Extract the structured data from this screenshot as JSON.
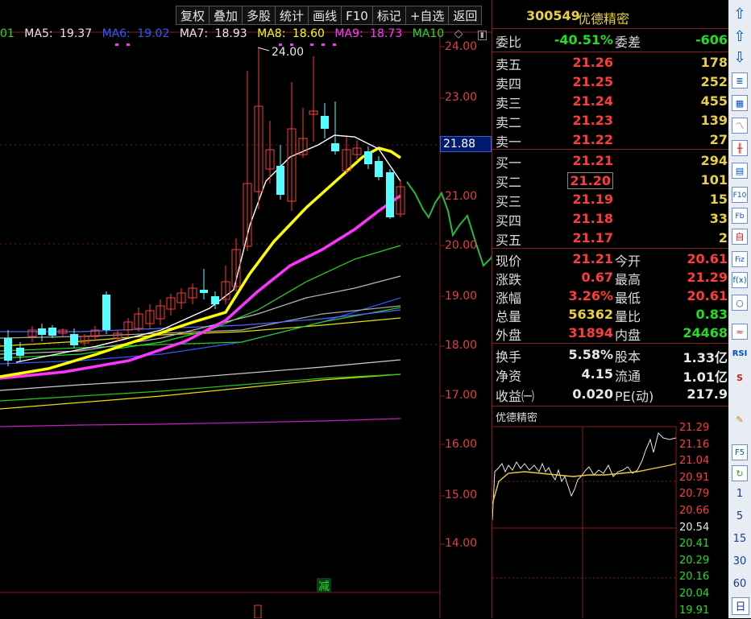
{
  "toolbar": {
    "items": [
      "复权",
      "叠加",
      "多股",
      "统计",
      "画线",
      "F10",
      "标记",
      "+自选",
      "返回"
    ]
  },
  "ma_legend": [
    {
      "label": "01",
      "value": "",
      "color": "#22dd22"
    },
    {
      "label": "MA5:",
      "value": "19.37",
      "color": "#e8e8e8"
    },
    {
      "label": "MA6:",
      "value": "19.02",
      "color": "#2a5cff"
    },
    {
      "label": "MA7:",
      "value": "18.93",
      "color": "#e8e8e8"
    },
    {
      "label": "MA8:",
      "value": "18.60",
      "color": "#ffff00"
    },
    {
      "label": "MA9:",
      "value": "18.73",
      "color": "#ff3cff"
    },
    {
      "label": "MA10",
      "value": "",
      "color": "#22dd22"
    }
  ],
  "chart": {
    "high_marker": "24.00",
    "current_price": "21.88",
    "y_labels": [
      "24.00",
      "23.00",
      "22.00",
      "21.00",
      "20.00",
      "19.00",
      "18.00",
      "17.00",
      "16.00",
      "15.00",
      "14.00"
    ],
    "subtract_label": "减"
  },
  "quote": {
    "code": "300549",
    "name": "优德精密",
    "weibi_label": "委比",
    "weibi": "-40.51%",
    "weicha_label": "委差",
    "weicha": "-606",
    "asks": [
      {
        "label": "卖五",
        "price": "21.26",
        "vol": "178"
      },
      {
        "label": "卖四",
        "price": "21.25",
        "vol": "252"
      },
      {
        "label": "卖三",
        "price": "21.24",
        "vol": "455"
      },
      {
        "label": "卖二",
        "price": "21.23",
        "vol": "139"
      },
      {
        "label": "卖一",
        "price": "21.22",
        "vol": "27"
      }
    ],
    "bids": [
      {
        "label": "买一",
        "price": "21.21",
        "vol": "294"
      },
      {
        "label": "买二",
        "price": "21.20",
        "vol": "101"
      },
      {
        "label": "买三",
        "price": "21.19",
        "vol": "15"
      },
      {
        "label": "买四",
        "price": "21.18",
        "vol": "33"
      },
      {
        "label": "买五",
        "price": "21.17",
        "vol": "2"
      }
    ],
    "stats": [
      {
        "l1": "现价",
        "v1": "21.21",
        "c1": "red",
        "l2": "今开",
        "v2": "20.61",
        "c2": "red"
      },
      {
        "l1": "涨跌",
        "v1": "0.67",
        "c1": "red",
        "l2": "最高",
        "v2": "21.29",
        "c2": "red"
      },
      {
        "l1": "涨幅",
        "v1": "3.26%",
        "c1": "red",
        "l2": "最低",
        "v2": "20.61",
        "c2": "red"
      },
      {
        "l1": "总量",
        "v1": "56362",
        "c1": "yel",
        "l2": "量比",
        "v2": "0.83",
        "c2": "grn"
      },
      {
        "l1": "外盘",
        "v1": "31894",
        "c1": "red",
        "l2": "内盘",
        "v2": "24468",
        "c2": "grn"
      }
    ],
    "stats2": [
      {
        "l1": "换手",
        "v1": "5.58%",
        "l2": "股本",
        "v2": "1.33亿"
      },
      {
        "l1": "净资",
        "v1": "4.15",
        "l2": "流通",
        "v2": "1.01亿"
      },
      {
        "l1": "收益㈠",
        "v1": "0.020",
        "l2": "PE(动)",
        "v2": "217.9"
      }
    ]
  },
  "mini": {
    "title": "优德精密",
    "y_labels": [
      "21.29",
      "21.16",
      "21.04",
      "20.91",
      "20.79",
      "20.66",
      "20.54",
      "20.41",
      "20.29",
      "20.16",
      "20.04",
      "19.91"
    ]
  },
  "right_sidebar": {
    "icons": [
      "arrow-up-icon",
      "arrow-up-outline-icon",
      "arrow-down-outline-icon",
      "list-icon",
      "table-icon",
      "line-chart-icon",
      "candle-icon",
      "grid-icon",
      "f10-icon",
      "f10b-icon",
      "self-icon",
      "fiz-icon",
      "fx-icon",
      "circle-icon",
      "wave-icon",
      "rsi-icon",
      "s-icon",
      "pen-icon",
      "f5-icon",
      "refresh-icon"
    ],
    "periods": [
      "1",
      "5",
      "15",
      "30",
      "60",
      "日"
    ]
  }
}
